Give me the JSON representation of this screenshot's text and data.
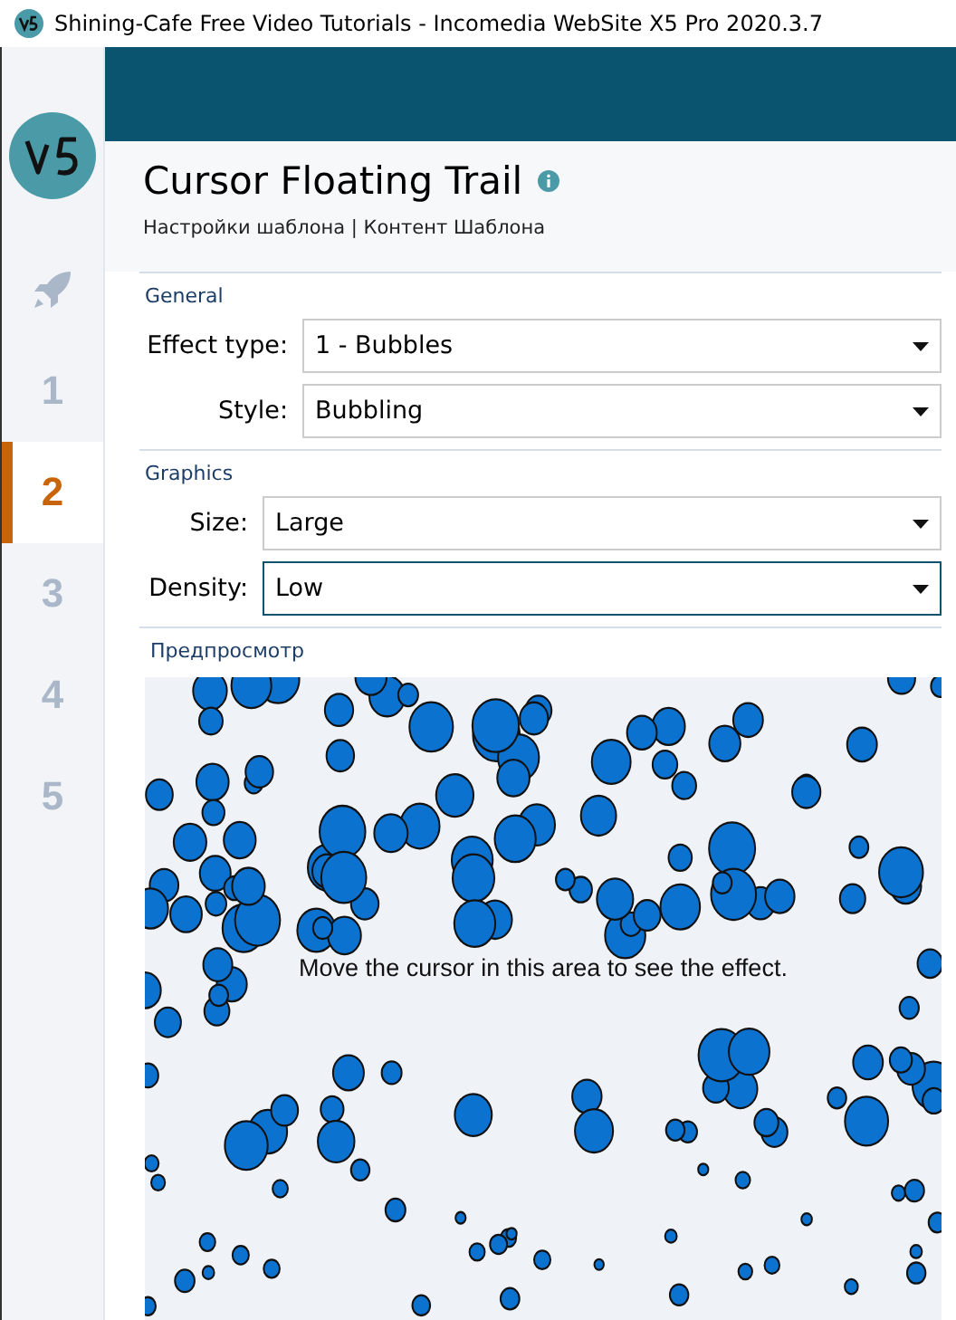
{
  "window": {
    "title": "Shining-Cafe Free Video Tutorials - Incomedia WebSite X5 Pro 2020.3.7"
  },
  "sidebar": {
    "items": [
      {
        "kind": "icon",
        "selected": false
      },
      {
        "kind": "number",
        "label": "1",
        "selected": false
      },
      {
        "kind": "number",
        "label": "2",
        "selected": true
      },
      {
        "kind": "number",
        "label": "3",
        "selected": false
      },
      {
        "kind": "number",
        "label": "4",
        "selected": false
      },
      {
        "kind": "number",
        "label": "5",
        "selected": false
      }
    ]
  },
  "header": {
    "title": "Cursor Floating Trail",
    "subtitle": "Настройки шаблона | Контент Шаблона"
  },
  "sections": [
    {
      "title": "General",
      "fields": [
        {
          "label": "Effect type:",
          "value": "1 - Bubbles",
          "focused": false
        },
        {
          "label": "Style:",
          "value": "Bubbling",
          "focused": false
        }
      ]
    },
    {
      "title": "Graphics",
      "fields": [
        {
          "label": "Size:",
          "value": "Large",
          "focused": false
        },
        {
          "label": "Density:",
          "value": "Low",
          "focused": true
        }
      ]
    }
  ],
  "preview": {
    "title": "Предпросмотр",
    "hint": "Move the cursor in this area to see the effect."
  }
}
